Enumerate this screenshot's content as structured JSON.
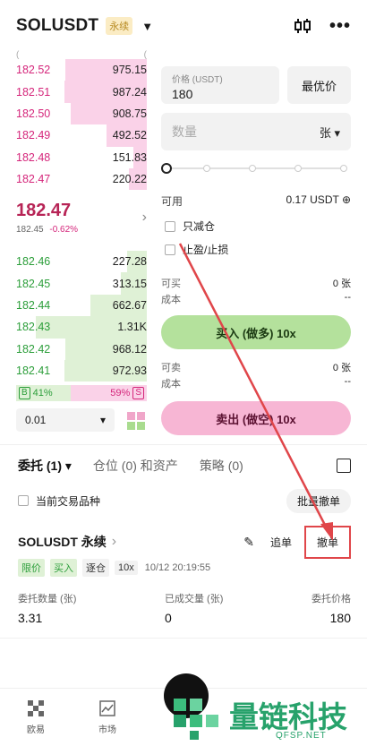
{
  "header": {
    "symbol": "SOLUSDT",
    "badge": "永续"
  },
  "orderbook": {
    "asks": [
      {
        "price": "182.52",
        "amount": "975.15",
        "depth": 0.62
      },
      {
        "price": "182.51",
        "amount": "987.24",
        "depth": 0.63
      },
      {
        "price": "182.50",
        "amount": "908.75",
        "depth": 0.58
      },
      {
        "price": "182.49",
        "amount": "492.52",
        "depth": 0.31
      },
      {
        "price": "182.48",
        "amount": "151.83",
        "depth": 0.1
      },
      {
        "price": "182.47",
        "amount": "220.22",
        "depth": 0.14
      }
    ],
    "last_price": "182.47",
    "mark_price": "182.45",
    "change": "-0.62%",
    "bids": [
      {
        "price": "182.46",
        "amount": "227.28",
        "depth": 0.15
      },
      {
        "price": "182.45",
        "amount": "313.15",
        "depth": 0.2
      },
      {
        "price": "182.44",
        "amount": "662.67",
        "depth": 0.43
      },
      {
        "price": "182.43",
        "amount": "1.31K",
        "depth": 0.85
      },
      {
        "price": "182.42",
        "amount": "968.12",
        "depth": 0.62
      },
      {
        "price": "182.41",
        "amount": "972.93",
        "depth": 0.63
      }
    ],
    "buy_tag": "B",
    "buy_pct": "41%",
    "sell_pct": "59%",
    "sell_tag": "S",
    "precision": "0.01"
  },
  "form": {
    "price_label": "价格 (USDT)",
    "price_value": "180",
    "best_price_btn": "最优价",
    "qty_placeholder": "数量",
    "qty_unit": "张",
    "slider_pct": 0,
    "available_label": "可用",
    "available_value": "0.17 USDT",
    "reduce_only": "只减仓",
    "tp_sl": "止盈/止损",
    "can_buy_label": "可买",
    "can_buy_value": "0 张",
    "cost_label": "成本",
    "cost_value": "--",
    "buy_btn": "买入 (做多) 10x",
    "can_sell_label": "可卖",
    "can_sell_value": "0 张",
    "cost2_label": "成本",
    "cost2_value": "--",
    "sell_btn": "卖出 (做空) 10x"
  },
  "tabs": {
    "orders": "委托 (1)",
    "positions": "仓位 (0) 和资产",
    "strategy": "策略 (0)"
  },
  "filter": {
    "current_only": "当前交易品种",
    "cancel_all": "批量撤单"
  },
  "order": {
    "name": "SOLUSDT 永续",
    "amend": "追单",
    "cancel": "撤单",
    "tag_type": "限价",
    "tag_side": "买入",
    "tag_mode": "逐仓",
    "tag_leverage": "10x",
    "time": "10/12 20:19:55",
    "qty_label": "委托数量 (张)",
    "qty_value": "3.31",
    "filled_label": "已成交量 (张)",
    "filled_value": "0",
    "price_label": "委托价格",
    "price_value": "180"
  },
  "nav": {
    "home": "欧易",
    "market": "市场"
  },
  "watermark": {
    "brand": "量链科技",
    "site": "QFSP.NET"
  },
  "colors": {
    "ask": "#d5267b",
    "bid": "#2c9e3a",
    "buy_button": "#b4e19c",
    "sell_button": "#f7b6d4",
    "highlight": "#e0464a"
  }
}
